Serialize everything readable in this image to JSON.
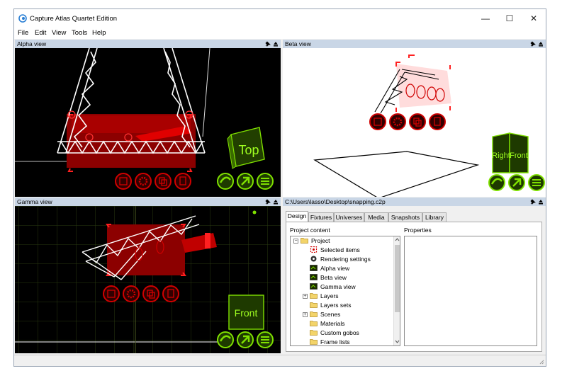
{
  "app": {
    "title": "Capture Atlas Quartet Edition"
  },
  "window_controls": {
    "minimize": "—",
    "maximize": "☐",
    "close": "✕"
  },
  "menu": [
    "File",
    "Edit",
    "View",
    "Tools",
    "Help"
  ],
  "views": {
    "alpha": {
      "title": "Alpha view",
      "cube_label": "Top"
    },
    "beta": {
      "title": "Beta view",
      "cube_left": "Right",
      "cube_right": "Front"
    },
    "gamma": {
      "title": "Gamma view",
      "cube_label": "Front"
    }
  },
  "project": {
    "path": "C:\\Users\\lasso\\Desktop\\snapping.c2p",
    "tabs": [
      "Design",
      "Fixtures",
      "Universes",
      "Media",
      "Snapshots",
      "Library"
    ],
    "active_tab": "Design",
    "content_label": "Project content",
    "properties_label": "Properties",
    "tree": [
      {
        "label": "Project",
        "icon": "folder-icon"
      },
      {
        "label": "Selected items",
        "icon": "selection-icon"
      },
      {
        "label": "Rendering settings",
        "icon": "render-settings-icon"
      },
      {
        "label": "Alpha view",
        "icon": "view-icon"
      },
      {
        "label": "Beta view",
        "icon": "view-icon"
      },
      {
        "label": "Gamma view",
        "icon": "view-icon"
      },
      {
        "label": "Layers",
        "icon": "folder-icon"
      },
      {
        "label": "Layers sets",
        "icon": "folder-icon"
      },
      {
        "label": "Scenes",
        "icon": "folder-icon"
      },
      {
        "label": "Materials",
        "icon": "folder-icon"
      },
      {
        "label": "Custom gobos",
        "icon": "folder-icon"
      },
      {
        "label": "Frame lists",
        "icon": "folder-icon"
      }
    ]
  },
  "colors": {
    "accent_green": "#7fe000",
    "accent_red": "#d00000",
    "pane_header": "#c9d6e6"
  }
}
